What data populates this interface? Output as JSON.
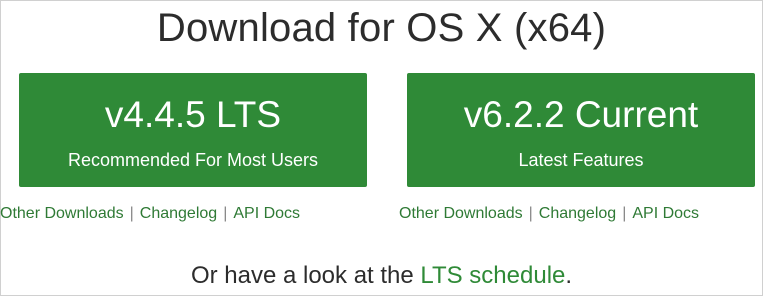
{
  "heading": "Download for OS X (x64)",
  "buttons": [
    {
      "version": "v4.4.5 LTS",
      "subtitle": "Recommended For Most Users"
    },
    {
      "version": "v6.2.2 Current",
      "subtitle": "Latest Features"
    }
  ],
  "links_left": {
    "other": "Other Downloads",
    "sep": "|",
    "changelog": "Changelog",
    "api": "API Docs"
  },
  "links_right": {
    "other": "Other Downloads",
    "sep": "|",
    "changelog": "Changelog",
    "api": "API Docs"
  },
  "footer": {
    "text": "Or have a look at the ",
    "link": "LTS schedule",
    "suffix": "."
  },
  "colors": {
    "brand_green": "#2f8a37",
    "link_green": "#2f7a35",
    "text": "#2c2c2c"
  }
}
